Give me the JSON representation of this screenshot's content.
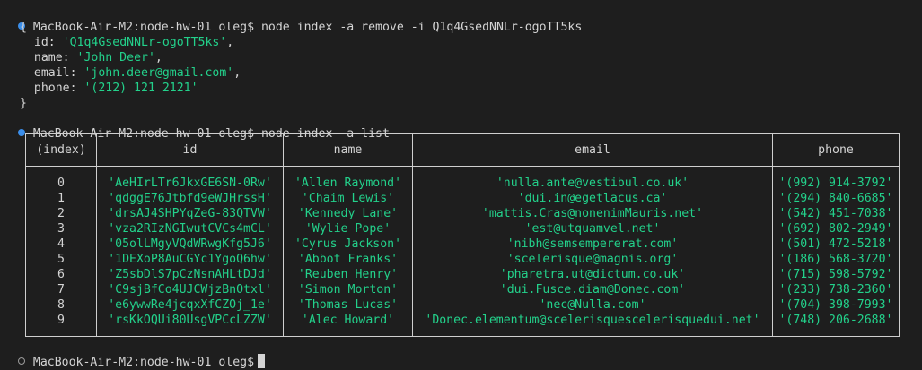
{
  "terminal": {
    "prompt": "MacBook-Air-M2:node-hw-01 oleg$",
    "commands": [
      "node index -a remove -i Q1q4GsedNNLr-ogoTT5ks",
      "node index -a list"
    ],
    "removed": {
      "open": "{",
      "close": "}",
      "fields": [
        {
          "key": "id",
          "value": "'Q1q4GsedNNLr-ogoTT5ks'"
        },
        {
          "key": "name",
          "value": "'John Deer'"
        },
        {
          "key": "email",
          "value": "'john.deer@gmail.com'"
        },
        {
          "key": "phone",
          "value": "'(212) 121 2121'"
        }
      ]
    },
    "colors": {
      "background": "#1e1e1e",
      "text": "#d4d4d4",
      "string": "#23d18b",
      "prompt_dot": "#3b8eea"
    }
  },
  "table": {
    "headers": [
      "(index)",
      "id",
      "name",
      "email",
      "phone"
    ],
    "rows": [
      {
        "index": "0",
        "id": "'AeHIrLTr6JkxGE6SN-0Rw'",
        "name": "'Allen Raymond'",
        "email": "'nulla.ante@vestibul.co.uk'",
        "phone": "'(992) 914-3792'"
      },
      {
        "index": "1",
        "id": "'qdggE76Jtbfd9eWJHrssH'",
        "name": "'Chaim Lewis'",
        "email": "'dui.in@egetlacus.ca'",
        "phone": "'(294) 840-6685'"
      },
      {
        "index": "2",
        "id": "'drsAJ4SHPYqZeG-83QTVW'",
        "name": "'Kennedy Lane'",
        "email": "'mattis.Cras@nonenimMauris.net'",
        "phone": "'(542) 451-7038'"
      },
      {
        "index": "3",
        "id": "'vza2RIzNGIwutCVCs4mCL'",
        "name": "'Wylie Pope'",
        "email": "'est@utquamvel.net'",
        "phone": "'(692) 802-2949'"
      },
      {
        "index": "4",
        "id": "'05olLMgyVQdWRwgKfg5J6'",
        "name": "'Cyrus Jackson'",
        "email": "'nibh@semsempererat.com'",
        "phone": "'(501) 472-5218'"
      },
      {
        "index": "5",
        "id": "'1DEXoP8AuCGYc1YgoQ6hw'",
        "name": "'Abbot Franks'",
        "email": "'scelerisque@magnis.org'",
        "phone": "'(186) 568-3720'"
      },
      {
        "index": "6",
        "id": "'Z5sbDlS7pCzNsnAHLtDJd'",
        "name": "'Reuben Henry'",
        "email": "'pharetra.ut@dictum.co.uk'",
        "phone": "'(715) 598-5792'"
      },
      {
        "index": "7",
        "id": "'C9sjBfCo4UJCWjzBnOtxl'",
        "name": "'Simon Morton'",
        "email": "'dui.Fusce.diam@Donec.com'",
        "phone": "'(233) 738-2360'"
      },
      {
        "index": "8",
        "id": "'e6ywwRe4jcqxXfCZOj_1e'",
        "name": "'Thomas Lucas'",
        "email": "'nec@Nulla.com'",
        "phone": "'(704) 398-7993'"
      },
      {
        "index": "9",
        "id": "'rsKkOQUi80UsgVPCcLZZW'",
        "name": "'Alec Howard'",
        "email": "'Donec.elementum@scelerisquescelerisquedui.net'",
        "phone": "'(748) 206-2688'"
      }
    ]
  }
}
